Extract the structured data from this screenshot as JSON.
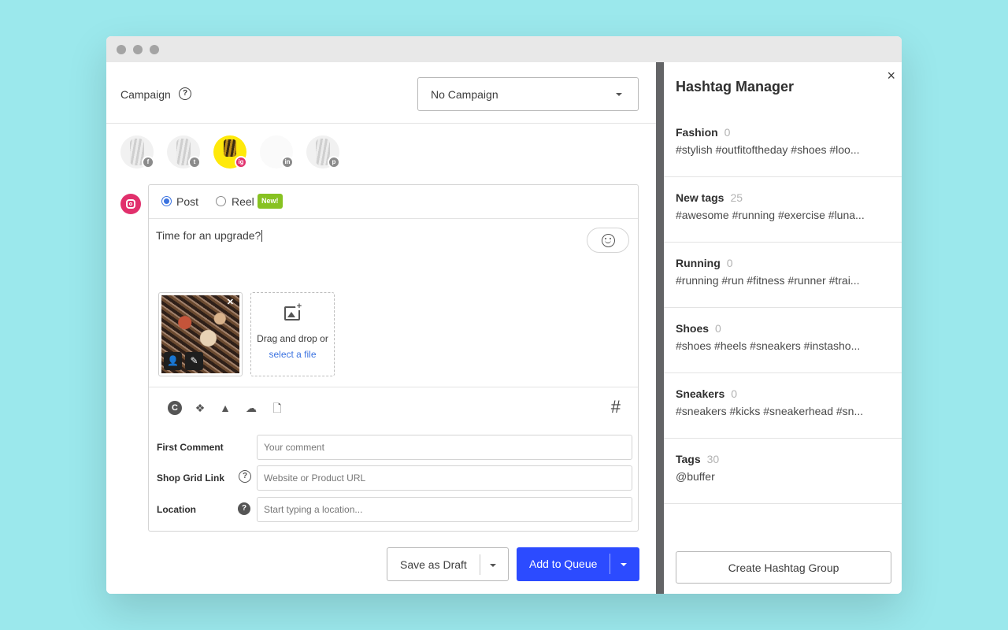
{
  "window": {
    "controls": [
      "close",
      "minimize",
      "zoom"
    ]
  },
  "campaign": {
    "label": "Campaign",
    "help": "?",
    "selected": "No Campaign"
  },
  "profiles": [
    {
      "network": "facebook",
      "badge": "f",
      "selected": false
    },
    {
      "network": "twitter",
      "badge": "t",
      "selected": false
    },
    {
      "network": "instagram",
      "badge": "ig",
      "selected": true
    },
    {
      "network": "linkedin",
      "badge": "in",
      "selected": false
    },
    {
      "network": "pinterest",
      "badge": "p",
      "selected": false
    }
  ],
  "composer": {
    "post_type": {
      "post_label": "Post",
      "reel_label": "Reel",
      "new_badge": "New!",
      "selected": "Post"
    },
    "text": "Time for an upgrade?",
    "media": {
      "dropzone_text": "Drag and drop or",
      "dropzone_link": "select a file"
    },
    "fields": {
      "first_comment": {
        "label": "First Comment",
        "placeholder": "Your comment"
      },
      "shop_grid_link": {
        "label": "Shop Grid Link",
        "placeholder": "Website or Product URL"
      },
      "location": {
        "label": "Location",
        "placeholder": "Start typing a location..."
      }
    }
  },
  "actions": {
    "save_draft": "Save as Draft",
    "add_queue": "Add to Queue"
  },
  "hashtag_manager": {
    "title": "Hashtag Manager",
    "close": "×",
    "groups": [
      {
        "name": "Fashion",
        "count": "0",
        "tags": "#stylish #outfitoftheday #shoes #loo..."
      },
      {
        "name": "New tags",
        "count": "25",
        "tags": "#awesome #running #exercise #luna..."
      },
      {
        "name": "Running",
        "count": "0",
        "tags": "#running #run #fitness #runner #trai..."
      },
      {
        "name": "Shoes",
        "count": "0",
        "tags": "#shoes #heels #sneakers #instasho..."
      },
      {
        "name": "Sneakers",
        "count": "0",
        "tags": "#sneakers #kicks #sneakerhead #sn..."
      },
      {
        "name": "Tags",
        "count": "30",
        "tags": "@buffer"
      }
    ],
    "create_label": "Create Hashtag Group"
  },
  "colors": {
    "accent": "#2c4bff",
    "instagram": "#e1306c",
    "new_badge": "#87c221",
    "background": "#9be8ec"
  }
}
